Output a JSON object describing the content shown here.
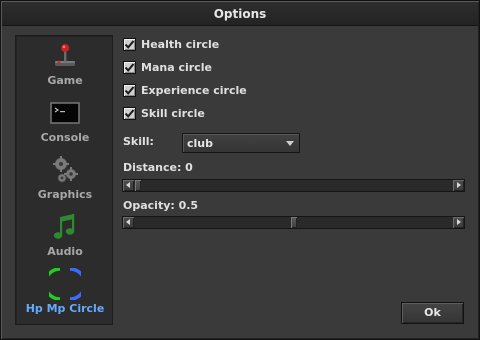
{
  "window": {
    "title": "Options"
  },
  "sidebar": {
    "items": [
      {
        "label": "Game",
        "icon": "joystick-icon",
        "active": false
      },
      {
        "label": "Console",
        "icon": "console-icon",
        "active": false
      },
      {
        "label": "Graphics",
        "icon": "gears-icon",
        "active": false
      },
      {
        "label": "Audio",
        "icon": "music-note-icon",
        "active": false
      },
      {
        "label": "Hp Mp Circle",
        "icon": "hp-mp-circle-icon",
        "active": true
      }
    ]
  },
  "options": {
    "checkboxes": [
      {
        "label": "Health circle",
        "checked": true
      },
      {
        "label": "Mana circle",
        "checked": true
      },
      {
        "label": "Experience circle",
        "checked": true
      },
      {
        "label": "Skill circle",
        "checked": true
      }
    ],
    "skill": {
      "label": "Skill:",
      "value": "club"
    },
    "distance": {
      "label": "Distance: 0",
      "value": 0
    },
    "opacity": {
      "label": "Opacity: 0.5",
      "value": 0.5
    }
  },
  "buttons": {
    "ok": "Ok"
  },
  "colors": {
    "accent": "#66aaff",
    "hp": "#22cc22",
    "mp": "#3a6cff"
  }
}
